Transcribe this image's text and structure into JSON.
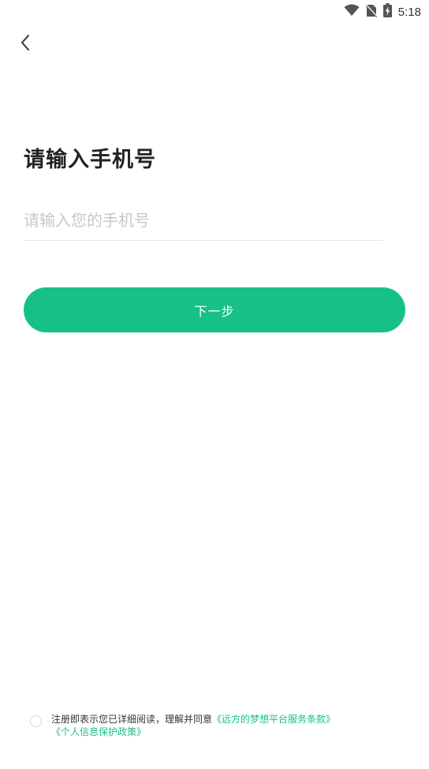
{
  "status_bar": {
    "time": "5:18",
    "icons": [
      "wifi-icon",
      "no-sim-icon",
      "battery-charging-icon"
    ]
  },
  "header": {
    "back_icon": "chevron-left-icon"
  },
  "page": {
    "title": "请输入手机号"
  },
  "phone_input": {
    "value": "",
    "placeholder": "请输入您的手机号"
  },
  "next_button": {
    "label": "下一步"
  },
  "agreement": {
    "prefix": "注册即表示您已详细阅读，理解并同意",
    "service_terms": "《远方的梦想平台服务条款》",
    "privacy_policy": "《个人信息保护政策》"
  },
  "colors": {
    "accent": "#17c088",
    "placeholder": "#c4c8cc",
    "divider": "#e6e6e6"
  }
}
